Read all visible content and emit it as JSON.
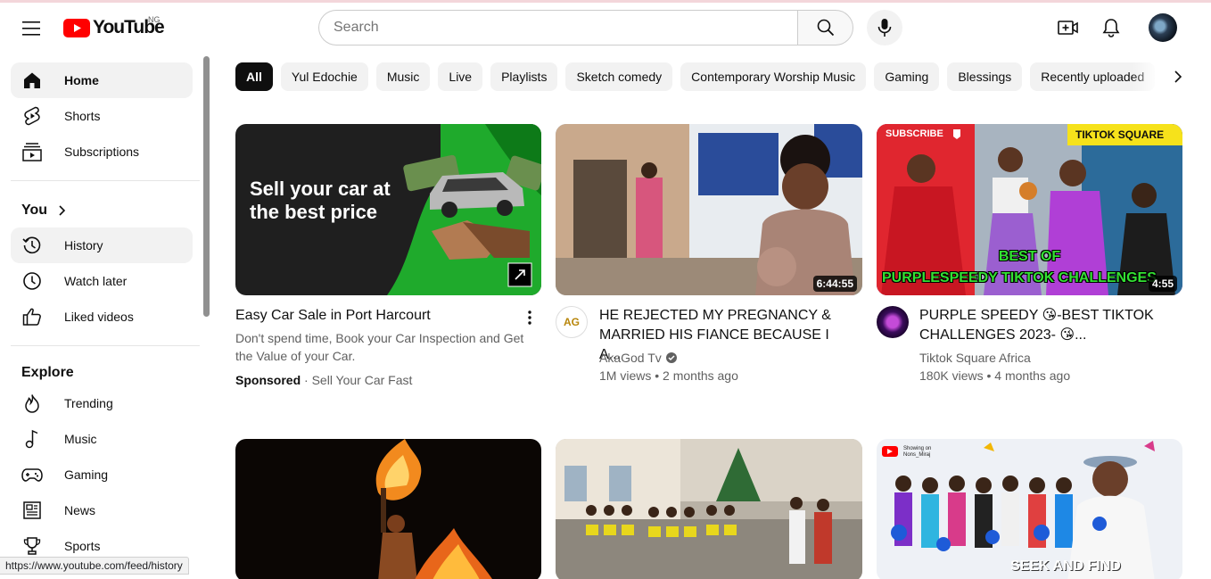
{
  "header": {
    "logo_text": "YouTube",
    "country_code": "NG",
    "search_placeholder": "Search"
  },
  "sidebar": {
    "main": [
      {
        "label": "Home",
        "icon": "home-icon"
      },
      {
        "label": "Shorts",
        "icon": "shorts-icon"
      },
      {
        "label": "Subscriptions",
        "icon": "subscriptions-icon"
      }
    ],
    "you_heading": "You",
    "you_items": [
      {
        "label": "History",
        "icon": "history-icon"
      },
      {
        "label": "Watch later",
        "icon": "watch-later-icon"
      },
      {
        "label": "Liked videos",
        "icon": "thumbs-up-icon"
      }
    ],
    "explore_heading": "Explore",
    "explore_items": [
      {
        "label": "Trending",
        "icon": "trending-icon"
      },
      {
        "label": "Music",
        "icon": "music-note-icon"
      },
      {
        "label": "Gaming",
        "icon": "gamepad-icon"
      },
      {
        "label": "News",
        "icon": "newspaper-icon"
      },
      {
        "label": "Sports",
        "icon": "trophy-icon"
      }
    ]
  },
  "chips": [
    "All",
    "Yul Edochie",
    "Music",
    "Live",
    "Playlists",
    "Sketch comedy",
    "Contemporary Worship Music",
    "Gaming",
    "Blessings",
    "Recently uploaded"
  ],
  "videos": [
    {
      "thumb_text": "Sell your car at the best price",
      "title": "Easy Car Sale in Port Harcourt",
      "description": "Don't spend time, Book your Car Inspection and Get the Value of your Car.",
      "sponsored": "Sponsored",
      "advertiser": "Sell Your Car Fast"
    },
    {
      "title": "HE REJECTED MY PREGNANCY & MARRIED HIS FIANCE BECAUSE I A...",
      "channel": "AkaGod Tv",
      "avatar_text": "AG",
      "views": "1M views",
      "age": "2 months ago",
      "duration": "6:44:55"
    },
    {
      "title": "PURPLE SPEEDY 😘-BEST TIKTOK CHALLENGES 2023- 😘...",
      "channel": "Tiktok Square Africa",
      "views": "180K views",
      "age": "4 months ago",
      "duration": "4:55",
      "thumb_subscribe": "SUBSCRIBE",
      "thumb_brand": "TIKTOK SQUARE",
      "thumb_caption_1": "BEST OF",
      "thumb_caption_2": "PURPLESPEEDY TIKTOK CHALLENGES"
    }
  ],
  "row2": {
    "thumb3_small": "Showing on Nons_Miraj",
    "thumb3_caption": "SEEK AND FIND"
  },
  "status_url": "https://www.youtube.com/feed/history"
}
